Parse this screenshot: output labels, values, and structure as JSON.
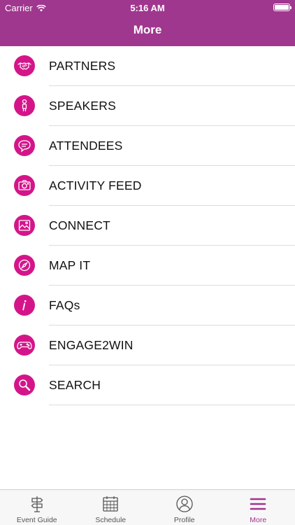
{
  "status_bar": {
    "carrier": "Carrier",
    "time": "5:16 AM"
  },
  "nav": {
    "title": "More"
  },
  "colors": {
    "header": "#a0378f",
    "icon_circle": "#d4158a",
    "tab_active": "#a0378f"
  },
  "menu": {
    "items": [
      {
        "label": "PARTNERS",
        "icon": "handshake-icon"
      },
      {
        "label": "SPEAKERS",
        "icon": "speaker-person-icon"
      },
      {
        "label": "ATTENDEES",
        "icon": "chat-bubble-icon"
      },
      {
        "label": "ACTIVITY FEED",
        "icon": "camera-icon"
      },
      {
        "label": "CONNECT",
        "icon": "photo-icon"
      },
      {
        "label": "MAP IT",
        "icon": "compass-icon"
      },
      {
        "label": "FAQs",
        "icon": "info-icon"
      },
      {
        "label": "ENGAGE2WIN",
        "icon": "gamepad-icon"
      },
      {
        "label": "SEARCH",
        "icon": "search-icon"
      }
    ]
  },
  "tabbar": {
    "tabs": [
      {
        "label": "Event Guide",
        "icon": "signpost-icon"
      },
      {
        "label": "Schedule",
        "icon": "calendar-icon"
      },
      {
        "label": "Profile",
        "icon": "profile-icon"
      },
      {
        "label": "More",
        "icon": "menu-icon",
        "active": true
      }
    ]
  }
}
